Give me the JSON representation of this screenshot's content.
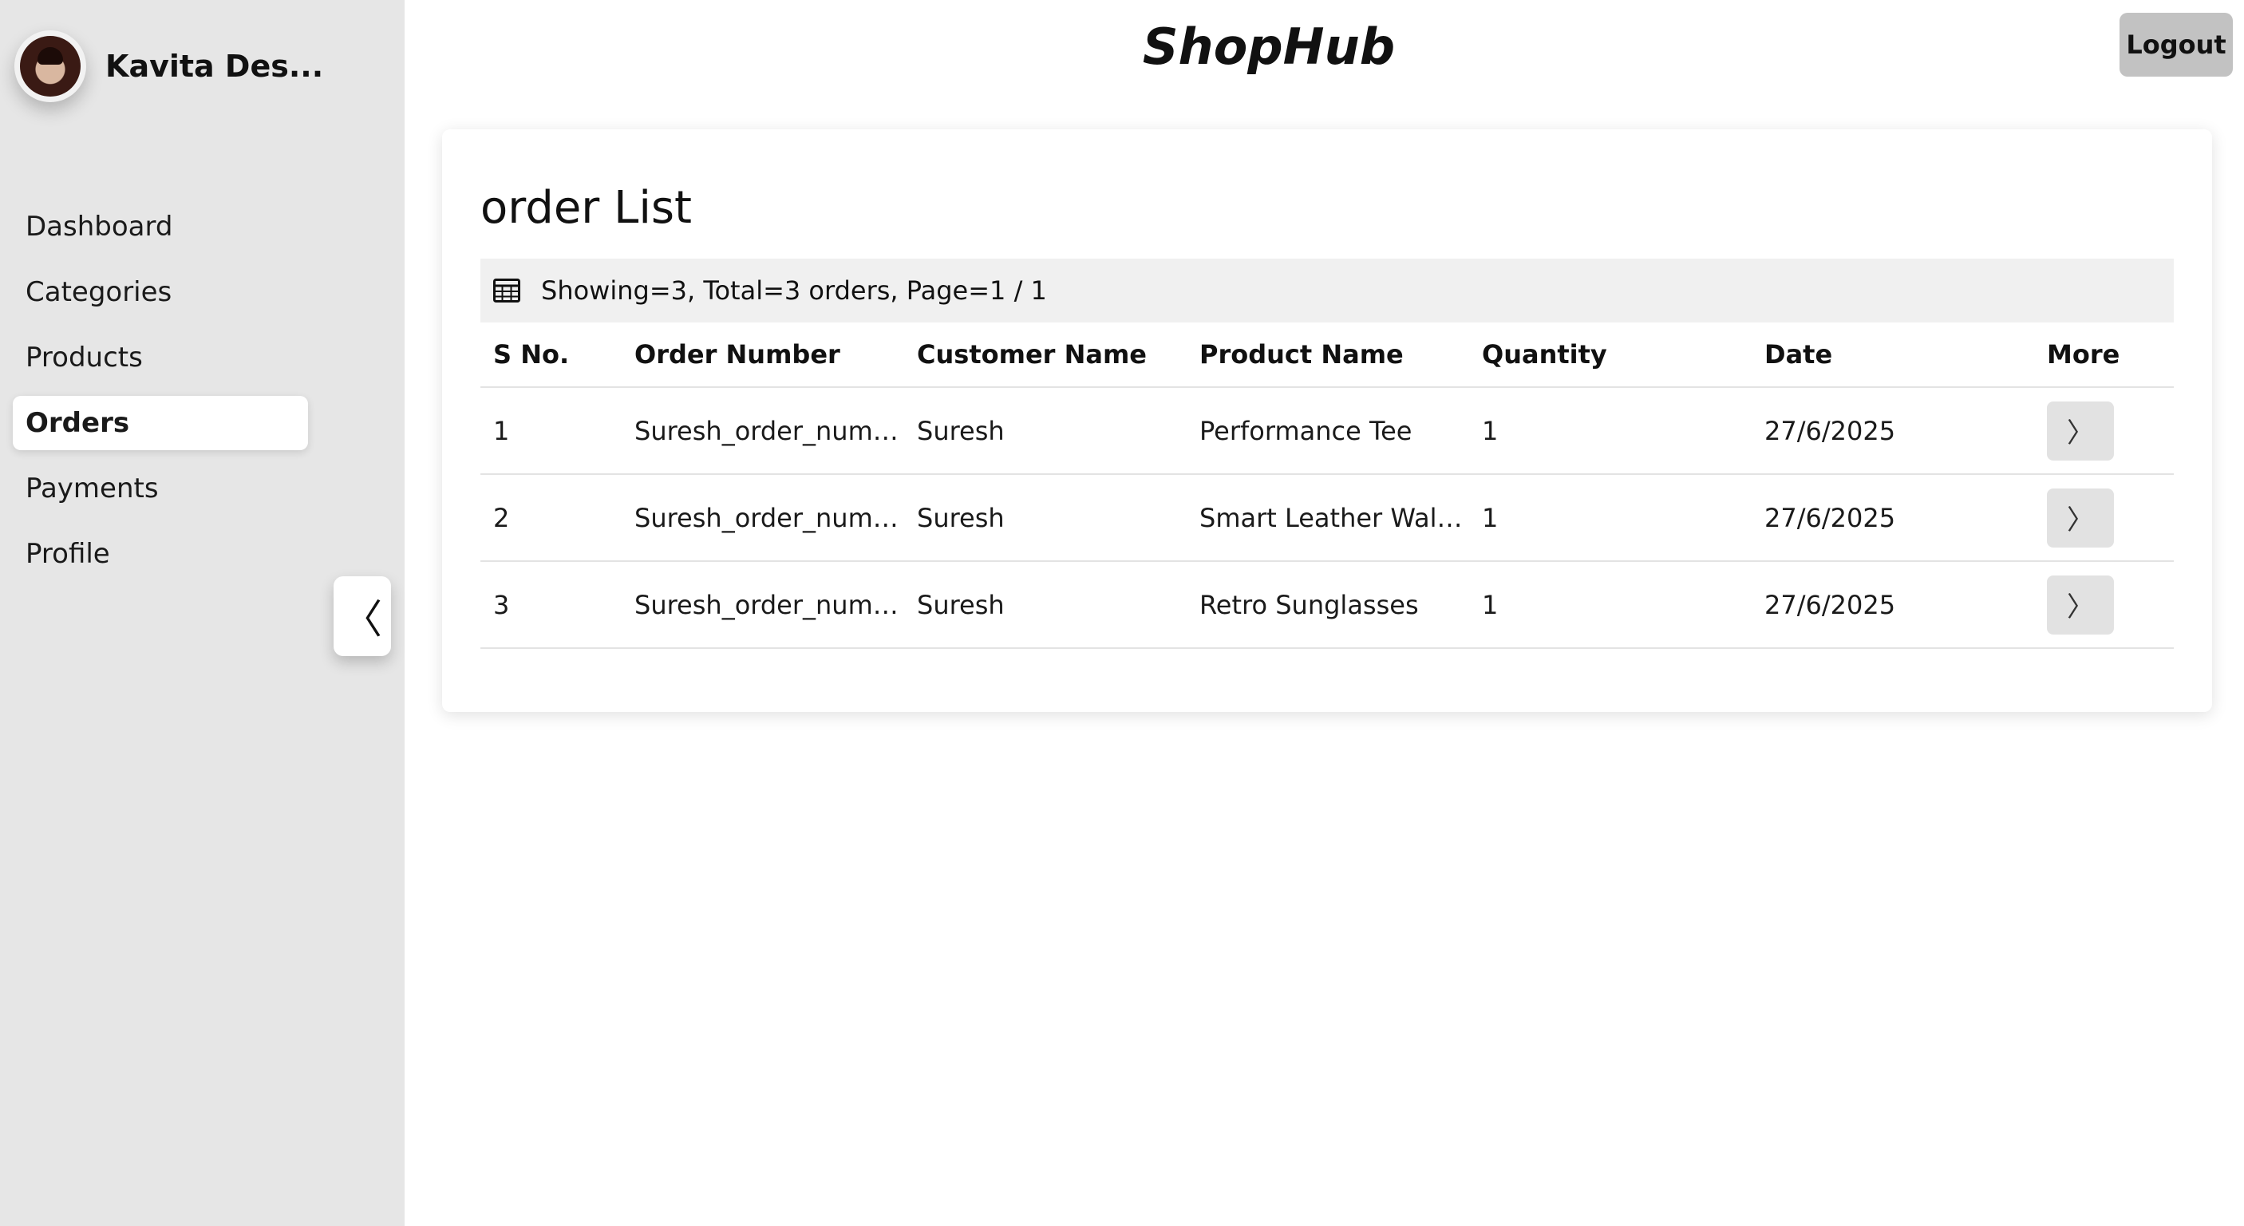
{
  "app": {
    "brand": "ShopHub",
    "logout_label": "Logout"
  },
  "user": {
    "name": "Kavita Des..."
  },
  "sidebar": {
    "items": [
      {
        "label": "Dashboard",
        "active": false
      },
      {
        "label": "Categories",
        "active": false
      },
      {
        "label": "Products",
        "active": false
      },
      {
        "label": "Orders",
        "active": true
      },
      {
        "label": "Payments",
        "active": false
      },
      {
        "label": "Profile",
        "active": false
      }
    ],
    "collapse_glyph": "〈"
  },
  "orders": {
    "title": "order List",
    "summary": "Showing=3, Total=3 orders, Page=1 / 1",
    "columns": [
      "S No.",
      "Order Number",
      "Customer Name",
      "Product Name",
      "Quantity",
      "Date",
      "More"
    ],
    "rows": [
      {
        "sno": "1",
        "order_number": "Suresh_order_numbe...",
        "customer": "Suresh",
        "product": "Performance Tee",
        "quantity": "1",
        "date": "27/6/2025",
        "more": "〉"
      },
      {
        "sno": "2",
        "order_number": "Suresh_order_numbe...",
        "customer": "Suresh",
        "product": "Smart Leather Wallet",
        "quantity": "1",
        "date": "27/6/2025",
        "more": "〉"
      },
      {
        "sno": "3",
        "order_number": "Suresh_order_numbe...",
        "customer": "Suresh",
        "product": "Retro Sunglasses",
        "quantity": "1",
        "date": "27/6/2025",
        "more": "〉"
      }
    ]
  },
  "colors": {
    "sidebar_bg": "#e6e6e6",
    "logout_bg": "#c2c2c2",
    "summary_bg": "#f0f0f0",
    "more_button_bg": "#e2e2e2"
  }
}
